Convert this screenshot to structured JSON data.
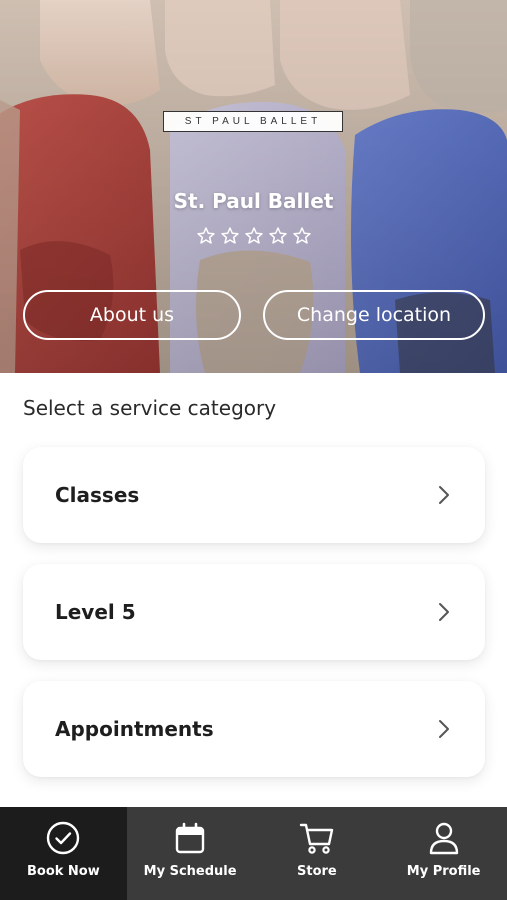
{
  "hero": {
    "logo_text": "ST PAUL BALLET",
    "studio_name": "St. Paul Ballet",
    "rating_stars": 5,
    "rating_filled": 0,
    "about_label": "About us",
    "location_label": "Change location"
  },
  "main": {
    "section_title": "Select a service category",
    "categories": [
      {
        "label": "Classes"
      },
      {
        "label": "Level 5"
      },
      {
        "label": "Appointments"
      }
    ]
  },
  "tabbar": {
    "tabs": [
      {
        "label": "Book Now",
        "icon": "check-circle-icon",
        "active": true
      },
      {
        "label": "My Schedule",
        "icon": "calendar-icon",
        "active": false
      },
      {
        "label": "Store",
        "icon": "cart-icon",
        "active": false
      },
      {
        "label": "My Profile",
        "icon": "user-icon",
        "active": false
      }
    ]
  },
  "colors": {
    "tabbar_bg": "#3b3b3b",
    "tab_active_bg": "#1c1c1c",
    "card_text": "#1e1e1e",
    "hero_text": "#ffffff"
  }
}
